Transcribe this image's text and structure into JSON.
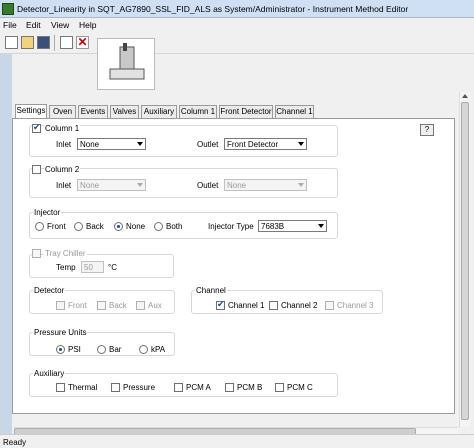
{
  "window": {
    "title": "Detector_Linearity in SQT_AG7890_SSL_FID_ALS as System/Administrator - Instrument Method Editor"
  },
  "menu": {
    "items": [
      "File",
      "Edit",
      "View",
      "Help"
    ]
  },
  "tabs": [
    "Settings",
    "Oven",
    "Events",
    "Valves",
    "Auxiliary",
    "Column 1",
    "Front Detector",
    "Channel 1"
  ],
  "help": "?",
  "column1": {
    "label": "Column 1",
    "inlet_label": "Inlet",
    "inlet_value": "None",
    "outlet_label": "Outlet",
    "outlet_value": "Front Detector"
  },
  "column2": {
    "label": "Column 2",
    "inlet_label": "Inlet",
    "inlet_value": "None",
    "outlet_label": "Outlet",
    "outlet_value": "None"
  },
  "injector": {
    "title": "Injector",
    "options": [
      "Front",
      "Back",
      "None",
      "Both"
    ],
    "selected": "None",
    "type_label": "Injector Type",
    "type_value": "7683B"
  },
  "tray": {
    "label": "Tray Chiller",
    "temp_label": "Temp",
    "temp_value": "50",
    "unit": "°C"
  },
  "detector": {
    "title": "Detector",
    "options": [
      "Front",
      "Back",
      "Aux"
    ]
  },
  "channel": {
    "title": "Channel",
    "options": [
      "Channel 1",
      "Channel 2",
      "Channel 3"
    ]
  },
  "pressure": {
    "title": "Pressure Units",
    "options": [
      "PSI",
      "Bar",
      "kPA"
    ],
    "selected": "PSI"
  },
  "auxiliary": {
    "title": "Auxiliary",
    "options": [
      "Thermal",
      "Pressure",
      "PCM A",
      "PCM B",
      "PCM C"
    ]
  },
  "status": "Ready"
}
